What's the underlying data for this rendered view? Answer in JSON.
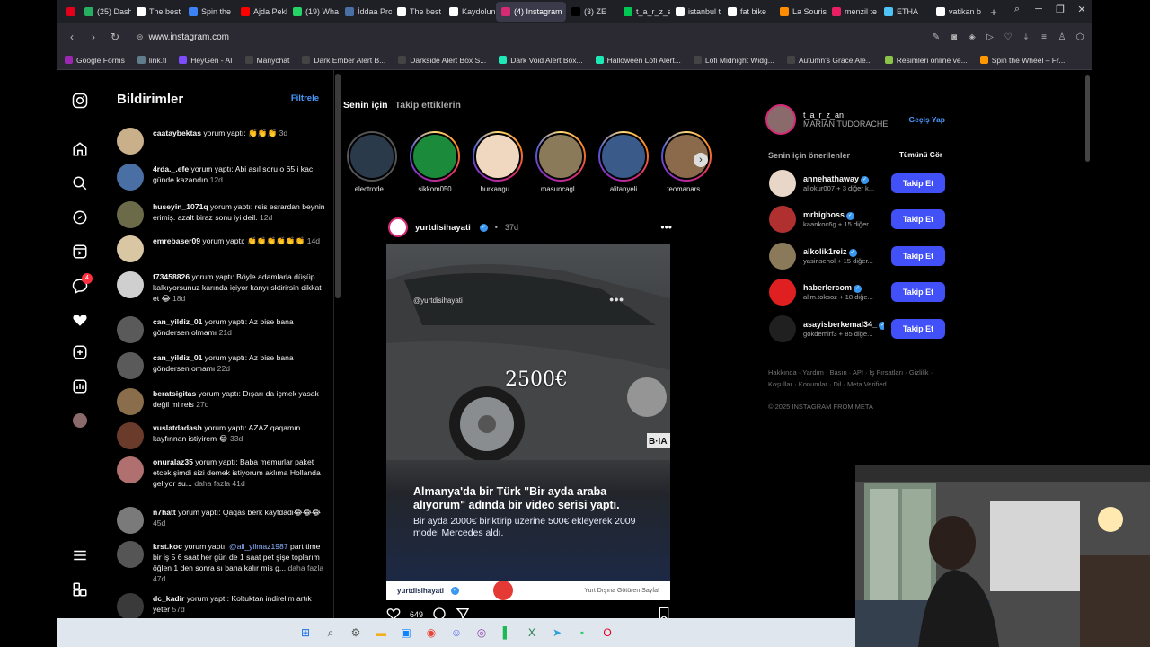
{
  "browser": {
    "tabs": [
      {
        "label": "",
        "color": "#e3001b",
        "active": false
      },
      {
        "label": "(25) Dash",
        "color": "#27ae60",
        "active": false
      },
      {
        "label": "The best",
        "color": "#ffffff",
        "active": false
      },
      {
        "label": "Spin the",
        "color": "#3b82f6",
        "active": false
      },
      {
        "label": "Ajda Pekk",
        "color": "#ff0000",
        "active": false
      },
      {
        "label": "(19) Wha",
        "color": "#25d366",
        "active": false
      },
      {
        "label": "İddaa Pro",
        "color": "#4a6fa5",
        "active": false
      },
      {
        "label": "The best",
        "color": "#ffffff",
        "active": false
      },
      {
        "label": "Kaydolun",
        "color": "#ffffff",
        "active": false
      },
      {
        "label": "(4) Instagram",
        "color": "#d62976",
        "active": true
      },
      {
        "label": "(3) ZE",
        "color": "#000000",
        "active": false
      },
      {
        "label": "t_a_r_z_an",
        "color": "#00c853",
        "active": false
      },
      {
        "label": "istanbul t",
        "color": "#ffffff",
        "active": false
      },
      {
        "label": "fat bike",
        "color": "#ffffff",
        "active": false
      },
      {
        "label": "La Souris",
        "color": "#ff8c00",
        "active": false
      },
      {
        "label": "menzil te",
        "color": "#e91e63",
        "active": false
      },
      {
        "label": "ETHA",
        "color": "#4fc3f7",
        "active": false
      },
      {
        "label": "vatikan b",
        "color": "#ffffff",
        "active": false
      }
    ],
    "url": "www.instagram.com",
    "bookmarks": [
      {
        "label": "Google Forms",
        "color": "#9c27b0"
      },
      {
        "label": "link.tl",
        "color": "#607d8b"
      },
      {
        "label": "HeyGen - AI",
        "color": "#7c4dff"
      },
      {
        "label": "Manychat",
        "color": "#444444"
      },
      {
        "label": "Dark Ember Alert B...",
        "color": "#444444"
      },
      {
        "label": "Darkside Alert Box S...",
        "color": "#444444"
      },
      {
        "label": "Dark Void Alert Box...",
        "color": "#1de9b6"
      },
      {
        "label": "Halloween Lofi Alert...",
        "color": "#1de9b6"
      },
      {
        "label": "Lofi Midnight Widg...",
        "color": "#444444"
      },
      {
        "label": "Autumn's Grace Ale...",
        "color": "#444444"
      },
      {
        "label": "Resimleri online ve...",
        "color": "#8bc34a"
      },
      {
        "label": "Spin the Wheel – Fr...",
        "color": "#ff9800"
      }
    ]
  },
  "notifications": {
    "title": "Bildirimler",
    "filter_label": "Filtrele",
    "items": [
      {
        "user": "caataybektas",
        "text": " yorum yaptı: 👏👏👏",
        "time": "3d",
        "color": "#c9b08a"
      },
      {
        "user": "4rda._.efe",
        "text": " yorum yaptı: Abi asıl soru o 65 i kac günde kazandın",
        "time": "12d",
        "color": "#4a6fa5"
      },
      {
        "user": "huseyin_1071q",
        "text": " yorum yaptı: reis esrardan beynin erimiş. azalt biraz sonu iyi deil.",
        "time": "12d",
        "color": "#6b6b4a"
      },
      {
        "user": "emrebaser09",
        "text": " yorum yaptı: 👏👏👏👏👏👏",
        "time": "14d",
        "color": "#d9c7a3"
      },
      {
        "user": "f73458826",
        "text": " yorum yaptı: Böyle adamlarla düşüp kalkıyorsunuz karında içiyor kanyı sktirirsin dikkat et 😂",
        "time": "18d",
        "color": "#cfcfcf"
      },
      {
        "user": "can_yildiz_01",
        "text": " yorum yaptı: Az bise bana göndersen olmamı",
        "time": "21d",
        "color": "#5a5a5a"
      },
      {
        "user": "can_yildiz_01",
        "text": " yorum yaptı: Az bise bana göndersen omamı",
        "time": "22d",
        "color": "#5a5a5a"
      },
      {
        "user": "beratsigitas",
        "text": " yorum yaptı: Dışarı da içmek yasak değil mi reis",
        "time": "27d",
        "color": "#8a6d4a"
      },
      {
        "user": "vuslatdadash",
        "text": " yorum yaptı: AZAZ qaqamın kayfınnan istiyirem 😂",
        "time": "33d",
        "color": "#6a3a2a"
      },
      {
        "user": "onuralaz35",
        "text": " yorum yaptı: Baba memurlar paket etcek şimdi sizi demek istiyorum aklıma Hollanda geliyor su...",
        "more": "daha fazla",
        "time": "41d",
        "color": "#b07070"
      },
      {
        "user": "n7hatt",
        "text": " yorum yaptı: Qaqas berk kayfdadi😂😂😂",
        "time": "45d",
        "color": "#7a7a7a"
      },
      {
        "user": "krst.koc",
        "text": " yorum yaptı: ",
        "mention": "@ali_yilmaz1987",
        "text2": " part time bir iş 5 6 saat her gün de 1 saat pet şişe toplarım öğlen 1 den sonra sı bana kalır mis g...",
        "more": "daha fazla",
        "time": "47d",
        "color": "#555555"
      },
      {
        "user": "dc_kadir",
        "text": " yorum yaptı: Koltuktan indirelim artık yeter",
        "time": "57d",
        "color": "#3a3a3a"
      }
    ]
  },
  "feed": {
    "tab_active": "Senin için",
    "tab_other": "Takip ettiklerin",
    "stories": [
      {
        "name": "electrode...",
        "seen": true,
        "color": "#2a3a4a"
      },
      {
        "name": "sikkom050",
        "seen": false,
        "color": "#1b8a3a"
      },
      {
        "name": "hurkangu...",
        "seen": false,
        "color": "#f0d7c0"
      },
      {
        "name": "masuncagl...",
        "seen": false,
        "color": "#8a7a5a"
      },
      {
        "name": "alitanyeli",
        "seen": false,
        "color": "#3a5a8a"
      },
      {
        "name": "teomanars...",
        "seen": false,
        "color": "#8a6a4a"
      }
    ],
    "post": {
      "username": "yurtdisihayati",
      "time": "37d",
      "watermark": "@yurtdisihayati",
      "price": "2500€",
      "plate": "B·IA",
      "headline": "Almanya'da bir Türk \"Bir ayda araba alıyorum\" adında bir video serisi yaptı.",
      "subhead": "Bir ayda 2000€ biriktirip üzerine 500€ ekleyerek 2009 model Mercedes aldı.",
      "footer_user": "yurtdisihayati",
      "footer_tagline": "Yurt Dışına Götüren Sayfa!",
      "likes": "649"
    }
  },
  "sidebar_right": {
    "me": {
      "username": "t_a_r_z_an",
      "fullname": "MARIAN TUDORACHE",
      "switch_label": "Geçiş Yap"
    },
    "suggestions_title": "Senin için önerilenler",
    "see_all": "Tümünü Gör",
    "follow_label": "Takip Et",
    "suggestions": [
      {
        "username": "annehathaway",
        "sub": "aliokur007 + 3 diğer k...",
        "color": "#e8d7c9"
      },
      {
        "username": "mrbigboss",
        "sub": "kaankoc6g + 15 diğer...",
        "color": "#b03030"
      },
      {
        "username": "alkolik1reiz",
        "sub": "yasinsenol + 15 diğer...",
        "color": "#8a7a5a"
      },
      {
        "username": "haberlercom",
        "sub": "alim.toksoz + 18 diğe...",
        "color": "#e02020"
      },
      {
        "username": "asayisberkemal34_",
        "sub": "gokdemirf3 + 85 diğe...",
        "color": "#202020"
      }
    ],
    "footer_links": "Hakkında · Yardım · Basın · API · İş Fırsatları · Gizlilik · Koşullar · Konumlar · Dil · Meta Verified",
    "copyright": "© 2025 INSTAGRAM FROM META"
  },
  "rail": {
    "messages_badge": "4"
  },
  "taskbar": {
    "icons": [
      {
        "name": "windows-start-icon",
        "glyph": "⊞",
        "color": "#1a73e8"
      },
      {
        "name": "search-icon",
        "glyph": "⌕",
        "color": "#333333"
      },
      {
        "name": "settings-icon",
        "glyph": "⚙",
        "color": "#555555"
      },
      {
        "name": "file-explorer-icon",
        "glyph": "▬",
        "color": "#f2b01e"
      },
      {
        "name": "photos-icon",
        "glyph": "▣",
        "color": "#0a84ff"
      },
      {
        "name": "chrome-icon",
        "glyph": "◉",
        "color": "#ea4335"
      },
      {
        "name": "discord-icon",
        "glyph": "☺",
        "color": "#5865f2"
      },
      {
        "name": "app-icon",
        "glyph": "◎",
        "color": "#8e44ad"
      },
      {
        "name": "notes-icon",
        "glyph": "▌",
        "color": "#1db954"
      },
      {
        "name": "excel-icon",
        "glyph": "X",
        "color": "#1d7a45"
      },
      {
        "name": "telegram-icon",
        "glyph": "➤",
        "color": "#2aa1da"
      },
      {
        "name": "terminal-icon",
        "glyph": "▪",
        "color": "#2ecc71"
      },
      {
        "name": "opera-icon",
        "glyph": "O",
        "color": "#e3001b"
      }
    ]
  }
}
